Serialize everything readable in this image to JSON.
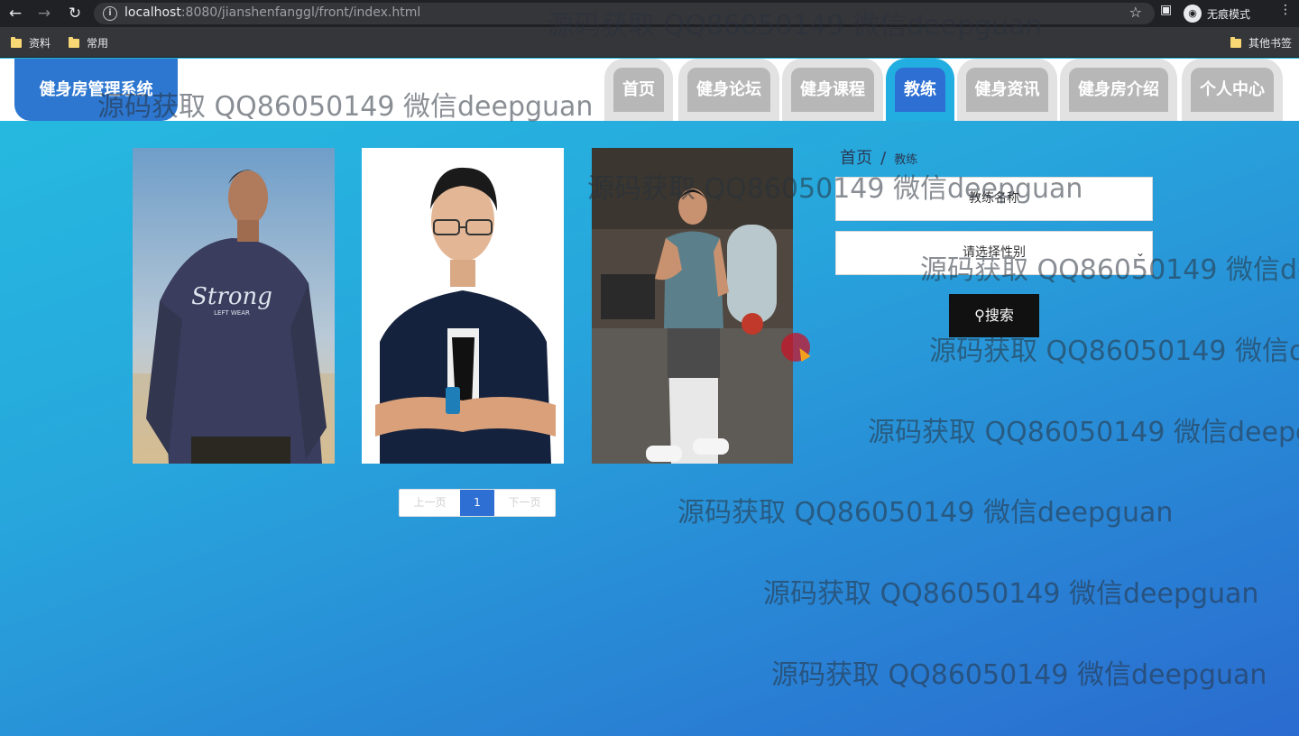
{
  "browser": {
    "url_host": "localhost",
    "url_rest": ":8080/jianshenfanggl/front/index.html",
    "incognito_label": "无痕模式",
    "bookmarks": [
      "资料",
      "常用"
    ],
    "other_bookmarks": "其他书签"
  },
  "header": {
    "logo": "健身房管理系统",
    "menu": [
      "首页",
      "健身论坛",
      "健身课程",
      "教练",
      "健身资讯",
      "健身房介绍",
      "个人中心"
    ],
    "active": "教练"
  },
  "breadcrumb": {
    "home": "首页",
    "separator": "/",
    "current": "教练"
  },
  "search": {
    "name_placeholder": "教练名称",
    "gender_select": "请选择性别",
    "button": "搜索"
  },
  "coaches": [
    {
      "shirt_text": "Strong",
      "shirt_sub": "LEFT WEAR"
    },
    {
      "shirt_text": ""
    },
    {
      "shirt_text": ""
    }
  ],
  "pagination": {
    "prev": "上一页",
    "page": "1",
    "next": "下一页"
  },
  "watermark": "源码获取 QQ86050149 微信deepguan"
}
